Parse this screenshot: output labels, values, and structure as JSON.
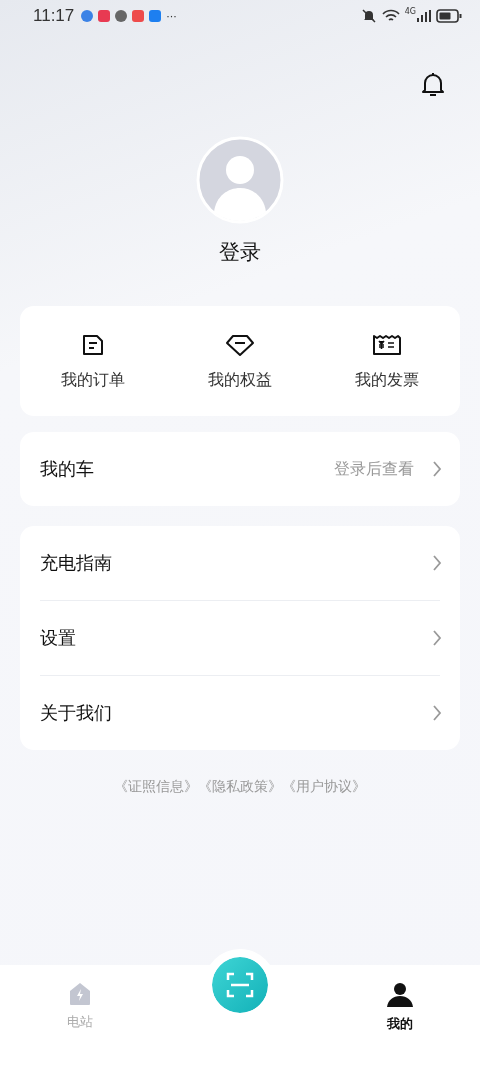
{
  "status_bar": {
    "time": "11:17",
    "more": "···",
    "network": "4G"
  },
  "profile": {
    "login": "登录"
  },
  "shortcuts": [
    {
      "label": "我的订单"
    },
    {
      "label": "我的权益"
    },
    {
      "label": "我的发票"
    }
  ],
  "my_car": {
    "label": "我的车",
    "hint": "登录后查看"
  },
  "menu": [
    {
      "label": "充电指南"
    },
    {
      "label": "设置"
    },
    {
      "label": "关于我们"
    }
  ],
  "legal_links": [
    "《证照信息》",
    "《隐私政策》",
    "《用户协议》"
  ],
  "tab_bar": {
    "tabs": [
      {
        "label": "电站",
        "selected": false
      },
      {
        "label": "我的",
        "selected": true
      }
    ]
  }
}
